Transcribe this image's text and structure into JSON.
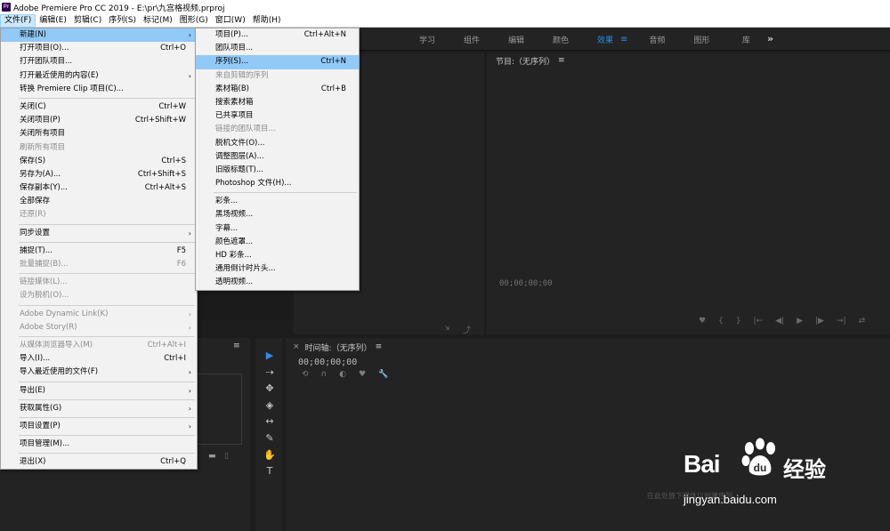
{
  "titlebar": {
    "icon": "Pr",
    "title": "Adobe Premiere Pro CC 2019 - E:\\pr\\九宫格视频.prproj"
  },
  "menubar": [
    {
      "label": "文件(F)",
      "active": true
    },
    {
      "label": "编辑(E)"
    },
    {
      "label": "剪辑(C)"
    },
    {
      "label": "序列(S)"
    },
    {
      "label": "标记(M)"
    },
    {
      "label": "图形(G)"
    },
    {
      "label": "窗口(W)"
    },
    {
      "label": "帮助(H)"
    }
  ],
  "workspace": {
    "tabs": [
      "学习",
      "组件",
      "编辑",
      "颜色",
      "效果",
      "音频",
      "图形",
      "库"
    ],
    "active_tab": "效果",
    "more": "»"
  },
  "file_menu": [
    {
      "label": "新建(N)",
      "submenu": true,
      "highlighted": true
    },
    {
      "label": "打开项目(O)...",
      "shortcut": "Ctrl+O"
    },
    {
      "label": "打开团队项目..."
    },
    {
      "label": "打开最近使用的内容(E)",
      "submenu": true
    },
    {
      "label": "转换 Premiere Clip 项目(C)..."
    },
    {
      "sep": true
    },
    {
      "label": "关闭(C)",
      "shortcut": "Ctrl+W"
    },
    {
      "label": "关闭项目(P)",
      "shortcut": "Ctrl+Shift+W"
    },
    {
      "label": "关闭所有项目"
    },
    {
      "label": "刷新所有项目",
      "disabled": true
    },
    {
      "label": "保存(S)",
      "shortcut": "Ctrl+S"
    },
    {
      "label": "另存为(A)...",
      "shortcut": "Ctrl+Shift+S"
    },
    {
      "label": "保存副本(Y)...",
      "shortcut": "Ctrl+Alt+S"
    },
    {
      "label": "全部保存"
    },
    {
      "label": "还原(R)",
      "disabled": true
    },
    {
      "sep": true
    },
    {
      "label": "同步设置",
      "submenu": true
    },
    {
      "sep": true
    },
    {
      "label": "捕捉(T)...",
      "shortcut": "F5"
    },
    {
      "label": "批量捕捉(B)...",
      "shortcut": "F6",
      "disabled": true
    },
    {
      "sep": true
    },
    {
      "label": "链接媒体(L)...",
      "disabled": true
    },
    {
      "label": "设为脱机(O)...",
      "disabled": true
    },
    {
      "sep": true
    },
    {
      "label": "Adobe Dynamic Link(K)",
      "submenu": true,
      "disabled": true
    },
    {
      "label": "Adobe Story(R)",
      "submenu": true,
      "disabled": true
    },
    {
      "sep": true
    },
    {
      "label": "从媒体浏览器导入(M)",
      "shortcut": "Ctrl+Alt+I",
      "disabled": true
    },
    {
      "label": "导入(I)...",
      "shortcut": "Ctrl+I"
    },
    {
      "label": "导入最近使用的文件(F)",
      "submenu": true
    },
    {
      "sep": true
    },
    {
      "label": "导出(E)",
      "submenu": true
    },
    {
      "sep": true
    },
    {
      "label": "获取属性(G)",
      "submenu": true
    },
    {
      "sep": true
    },
    {
      "label": "项目设置(P)",
      "submenu": true
    },
    {
      "sep": true
    },
    {
      "label": "项目管理(M)..."
    },
    {
      "sep": true
    },
    {
      "label": "退出(X)",
      "shortcut": "Ctrl+Q"
    }
  ],
  "new_submenu": [
    {
      "label": "项目(P)...",
      "shortcut": "Ctrl+Alt+N"
    },
    {
      "label": "团队项目..."
    },
    {
      "label": "序列(S)...",
      "shortcut": "Ctrl+N",
      "highlighted": true
    },
    {
      "label": "来自剪辑的序列",
      "disabled": true
    },
    {
      "label": "素材箱(B)",
      "shortcut": "Ctrl+B"
    },
    {
      "label": "搜索素材箱"
    },
    {
      "label": "已共享项目"
    },
    {
      "label": "链接的团队项目...",
      "disabled": true
    },
    {
      "label": "脱机文件(O)..."
    },
    {
      "label": "调整图层(A)..."
    },
    {
      "label": "旧版标题(T)..."
    },
    {
      "label": "Photoshop 文件(H)..."
    },
    {
      "sep": true
    },
    {
      "label": "彩条..."
    },
    {
      "label": "黑场视频..."
    },
    {
      "label": "字幕..."
    },
    {
      "label": "颜色遮罩..."
    },
    {
      "label": "HD 彩条..."
    },
    {
      "label": "通用倒计时片头..."
    },
    {
      "label": "透明视频..."
    }
  ],
  "program_monitor": {
    "title": "节目:（无序列）",
    "menu_icon": "≡",
    "timecode": "00;00;00;00",
    "controls": [
      "♥",
      "{",
      "}",
      "|←",
      "◀|",
      "▶",
      "|▶",
      "→|",
      "⇄"
    ]
  },
  "source_monitor": {
    "controls": [
      "⇲",
      "⤴"
    ]
  },
  "project_panel": {
    "menu_icon": "≡",
    "footer_icons": [
      "▬",
      "▯"
    ]
  },
  "tools": [
    "▶",
    "⇢",
    "✥",
    "◈",
    "↔",
    "✎",
    "✋",
    "T"
  ],
  "timeline": {
    "close": "×",
    "title": "时间轴:（无序列）",
    "menu_icon": "≡",
    "timecode": "00;00;00;00",
    "tool_icons": [
      "⟲",
      "∩",
      "◐",
      "♥",
      "🔧"
    ],
    "drop_hint": "在此处放下媒体以创建序列。"
  },
  "watermark": {
    "logo": "Bai",
    "cn": "经验",
    "url": "jingyan.baidu.com"
  }
}
